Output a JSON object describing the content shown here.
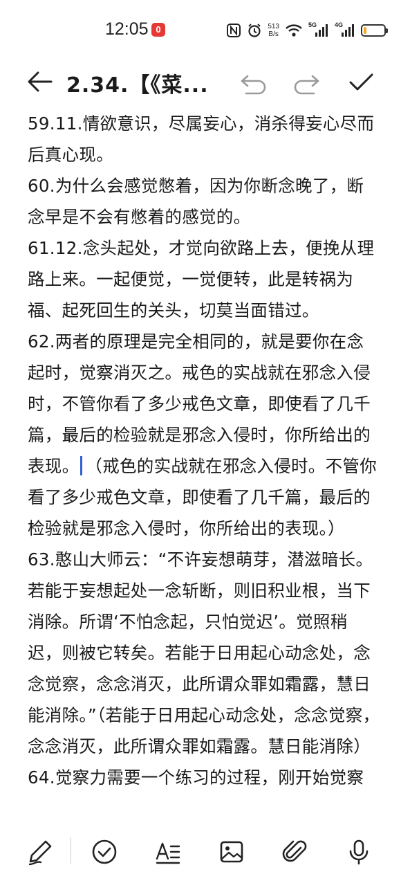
{
  "status_bar": {
    "time": "12:05",
    "notification_badge": "0",
    "net_speed_value": "513",
    "net_speed_unit": "B/s",
    "signal_1_label": "5G",
    "signal_2_label": "4G",
    "battery_level": 0.15,
    "battery_color": "#f5a623"
  },
  "toolbar": {
    "title": "2.34.【《菜..."
  },
  "note": {
    "paragraphs": [
      "59.11.情欲意识，尽属妄心，消杀得妄心尽而后真心现。",
      "60.为什么会感觉憋着，因为你断念晚了，断念早是不会有憋着的感觉的。",
      "61.12.念头起处，才觉向欲路上去，便挽从理路上来。一起便觉，一觉便转，此是转祸为福、起死回生的关头，切莫当面错过。",
      "63.憨山大师云：“不许妄想萌芽，潜滋暗长。若能于妄想起处一念斩断，则旧积业根，当下消除。所谓‘不怕念起，只怕觉迟’。觉照稍迟，则被它转矣。若能于日用起心动念处，念念觉察，念念消灭，此所谓众罪如霜露，慧日能消除。”（若能于日用起心动念处，念念觉察，念念消灭，此所谓众罪如霜露。慧日能消除）",
      "64.觉察力需要一个练习的过程，刚开始觉察"
    ],
    "para62_before_cursor": "62.两者的原理是完全相同的，就是要你在念起时，觉察消灭之。戒色的实战就在邪念入侵时，不管你看了多少戒色文章，即使看了几千篇，最后的检验就是邪念入侵时，你所给出的表现。",
    "para62_after_cursor": "（戒色的实战就在邪念入侵时。不管你看了多少戒色文章，即使看了几千篇，最后的检验就是邪念入侵时，你所给出的表现。）"
  },
  "accent_color": "#2f5fd6"
}
